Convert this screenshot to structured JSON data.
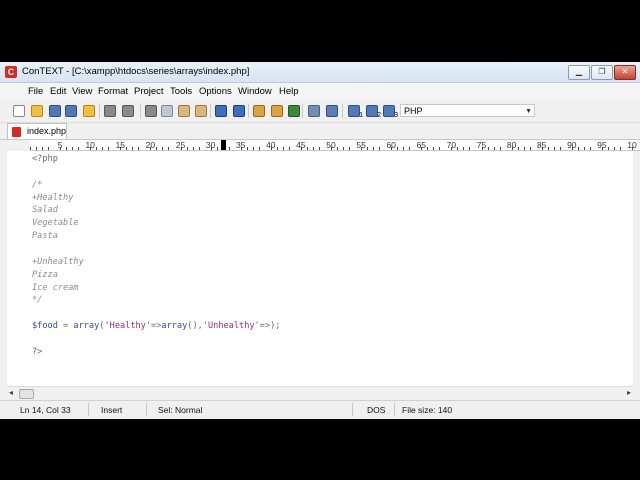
{
  "window": {
    "title": "ConTEXT - [C:\\xampp\\htdocs\\series\\arrays\\index.php]",
    "app_icon_letter": "C"
  },
  "window_buttons": {
    "minimize": "▁",
    "restore": "❐",
    "close": "✕"
  },
  "menu": [
    "File",
    "Edit",
    "View",
    "Format",
    "Project",
    "Tools",
    "Options",
    "Window",
    "Help"
  ],
  "toolbar": {
    "language": "PHP",
    "icons": [
      "new-file-icon",
      "open-icon",
      "save-icon",
      "save-all-icon",
      "open-folder-icon",
      "print-icon",
      "print-preview-icon",
      "cut-icon",
      "copy-icon",
      "paste-icon",
      "paste-special-icon",
      "undo-icon",
      "redo-icon",
      "find-icon",
      "find-next-icon",
      "replace-icon",
      "export-icon",
      "tools-icon",
      "user-cmd1-icon",
      "user-cmd2-icon",
      "user-cmd3-icon",
      "user-cmd4-icon"
    ],
    "user_cmd_labels": [
      "1",
      "2",
      "3",
      "4"
    ]
  },
  "tab": {
    "label": "index.php"
  },
  "ruler": {
    "numbers": [
      "5",
      "10",
      "15",
      "20",
      "25",
      "30",
      "35",
      "40",
      "45",
      "50",
      "55",
      "60",
      "65",
      "70",
      "75",
      "80",
      "85",
      "90",
      "95",
      "10"
    ]
  },
  "code": {
    "lines": [
      [
        {
          "t": "<?php",
          "c": "tag"
        }
      ],
      [],
      [
        {
          "t": "/*",
          "c": "com"
        }
      ],
      [
        {
          "t": "+Healthy",
          "c": "com"
        }
      ],
      [
        {
          "t": "Salad",
          "c": "com"
        }
      ],
      [
        {
          "t": "Vegetable",
          "c": "com"
        }
      ],
      [
        {
          "t": "Pasta",
          "c": "com"
        }
      ],
      [],
      [
        {
          "t": "+Unhealthy",
          "c": "com"
        }
      ],
      [
        {
          "t": "Pizza",
          "c": "com"
        }
      ],
      [
        {
          "t": "Ice cream",
          "c": "com"
        }
      ],
      [
        {
          "t": "*/",
          "c": "com"
        }
      ],
      [],
      [
        {
          "t": "$food",
          "c": "var"
        },
        {
          "t": " = ",
          "c": "op"
        },
        {
          "t": "array",
          "c": "kw"
        },
        {
          "t": "(",
          "c": "op"
        },
        {
          "t": "'Healthy'",
          "c": "str"
        },
        {
          "t": "=>",
          "c": "op"
        },
        {
          "t": "array",
          "c": "kw"
        },
        {
          "t": "(),",
          "c": "op"
        },
        {
          "t": "'Unhealthy'",
          "c": "str"
        },
        {
          "t": "=>);",
          "c": "op"
        }
      ],
      [],
      [
        {
          "t": "?>",
          "c": "tag"
        }
      ]
    ]
  },
  "scrollbar": {
    "left_arrow": "◂",
    "right_arrow": "▸"
  },
  "status": {
    "position": "Ln 14, Col 33",
    "mode": "Insert",
    "selection": "Sel: Normal",
    "line_ending": "DOS",
    "file_size": "File size: 140"
  },
  "colors": {
    "accent": "#d42b1e",
    "variable": "#2a4fb3",
    "string": "#9a2a8f",
    "comment": "#8c8c8c"
  }
}
